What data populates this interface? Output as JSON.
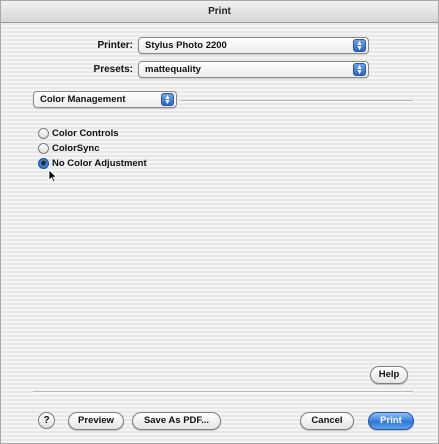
{
  "window": {
    "title": "Print"
  },
  "printer": {
    "label": "Printer:",
    "value": "Stylus Photo 2200"
  },
  "presets": {
    "label": "Presets:",
    "value": "mattequality"
  },
  "section": {
    "value": "Color Management"
  },
  "color_options": [
    {
      "label": "Color Controls",
      "selected": false
    },
    {
      "label": "ColorSync",
      "selected": false
    },
    {
      "label": "No Color Adjustment",
      "selected": true
    }
  ],
  "buttons": {
    "help_small": "Help",
    "help_circle": "?",
    "preview": "Preview",
    "save_as_pdf": "Save As PDF...",
    "cancel": "Cancel",
    "print": "Print"
  },
  "icons": {
    "popup_arrows": "up-down-arrows-icon",
    "cursor": "arrow-pointer-icon",
    "help": "question-mark-icon"
  },
  "colors": {
    "accent": "#2f78d8"
  }
}
